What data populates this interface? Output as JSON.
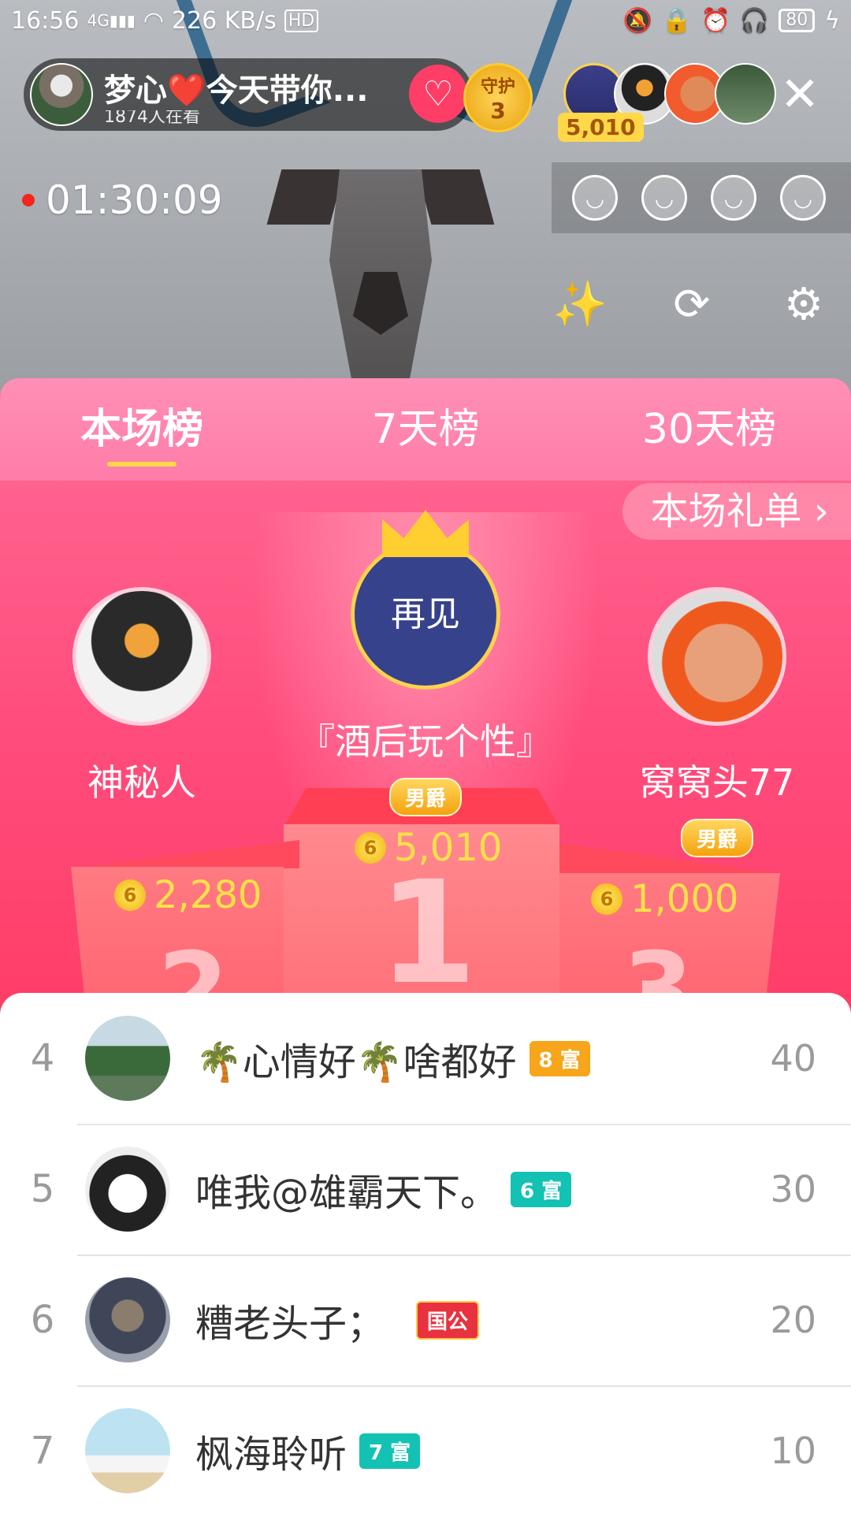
{
  "status_bar": {
    "time": "16:56",
    "network": "4G",
    "speed": "226 KB/s",
    "hd": "HD",
    "battery": "80"
  },
  "host": {
    "name": "梦心❤️今天带你...",
    "viewers": "1874人在看",
    "guard_label": "守护",
    "guard_count": "3"
  },
  "top_viewers": {
    "coin_count": "5,010"
  },
  "live": {
    "timer": "01:30:09"
  },
  "tabs": [
    {
      "label": "本场榜"
    },
    {
      "label": "7天榜"
    },
    {
      "label": "30天榜"
    }
  ],
  "gift_list_link": "本场礼单 ›",
  "podium": {
    "first": {
      "name": "『酒后玩个性』",
      "badge": "男爵",
      "score": "5,010",
      "avatar_text": "再见"
    },
    "second": {
      "name": "神秘人",
      "score": "2,280"
    },
    "third": {
      "name": "窝窝头77",
      "badge": "男爵",
      "score": "1,000"
    }
  },
  "list": [
    {
      "rank": "4",
      "name": "🌴心情好🌴啥都好",
      "level": "8 富",
      "level_color": "#f7a51a",
      "value": "40"
    },
    {
      "rank": "5",
      "name": "唯我@雄霸天下。",
      "level": "6 富",
      "level_color": "#13c2b3",
      "value": "30"
    },
    {
      "rank": "6",
      "name": "糟老头子；",
      "level": "国公",
      "level_color": "#e8323f",
      "value": "20"
    },
    {
      "rank": "7",
      "name": "枫海聆听",
      "level": "7 富",
      "level_color": "#13c2b3",
      "value": "10"
    }
  ],
  "colors": {
    "accent": "#ff4d7e",
    "coin": "#ffe14a"
  }
}
